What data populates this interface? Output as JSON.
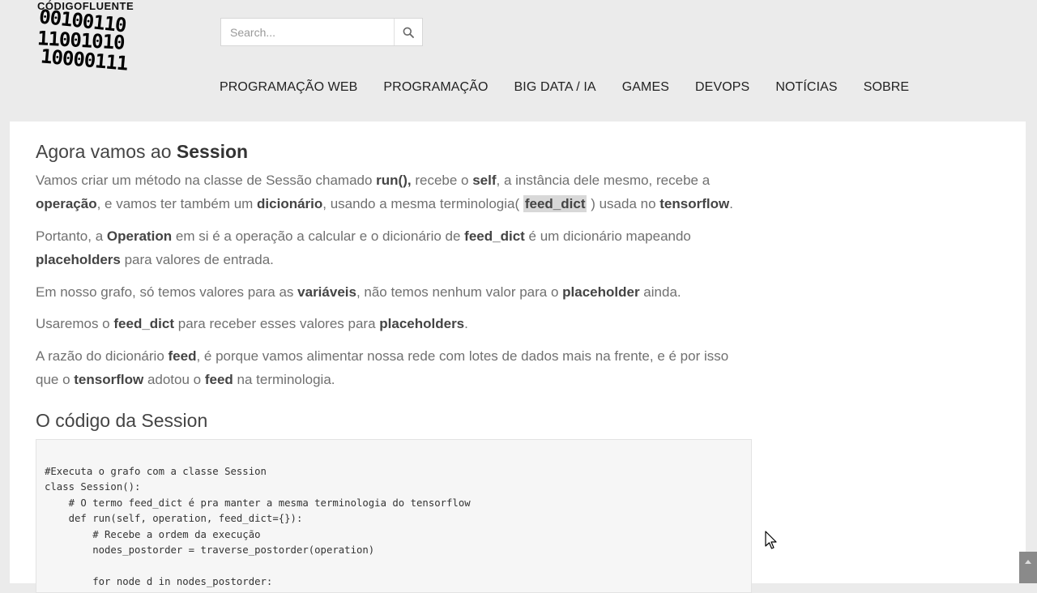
{
  "logo": {
    "name": "CÓDIGOFLUENTE",
    "bits": [
      "00100110",
      "11001010",
      "10000111"
    ]
  },
  "search": {
    "placeholder": "Search..."
  },
  "nav": [
    "PROGRAMAÇÃO WEB",
    "PROGRAMAÇÃO",
    "BIG DATA / IA",
    "GAMES",
    "DEVOPS",
    "NOTÍCIAS",
    "SOBRE"
  ],
  "article": {
    "heading1_prefix": "Agora vamos ao",
    "heading1_bold": "Session",
    "p1": {
      "t1": "Vamos criar um método na classe de Sessão chamado ",
      "b1": "run(),",
      "t2": "  recebe o ",
      "b2": "self",
      "t3": ", a instância dele mesmo, recebe a ",
      "b3": "operação",
      "t4": ", e vamos ter também um ",
      "b4": "dicionário",
      "t5": ", usando a mesma terminologia( ",
      "b5": "feed_dict",
      "t6": " ) usada no ",
      "b6": "tensorflow",
      "t7": "."
    },
    "p2": {
      "t1": "Portanto, a ",
      "b1": "Operation",
      "t2": " em si é a operação a calcular e o dicionário de ",
      "b2": "feed_dict",
      "t3": " é um dicionário mapeando ",
      "b3": "placeholders",
      "t4": " para valores de entrada."
    },
    "p3": {
      "t1": "Em nosso grafo, só temos valores para as ",
      "b1": "variáveis",
      "t2": ", não temos nenhum valor para o ",
      "b2": "placeholder",
      "t3": " ainda."
    },
    "p4": {
      "t1": "Usaremos o ",
      "b1": "feed_dict",
      "t2": " para receber esses valores para ",
      "b2": "placeholders",
      "t3": "."
    },
    "p5": {
      "t1": "A razão do dicionário ",
      "b1": "feed",
      "t2": ", é porque vamos alimentar nossa rede com lotes de dados mais na frente, e é por isso que o ",
      "b2": "tensorflow",
      "t3": " adotou o ",
      "b3": "feed",
      "t4": " na terminologia."
    },
    "heading2": "O código da Session",
    "code": "#Executa o grafo com a classe Session\nclass Session():\n    # O termo feed_dict é pra manter a mesma terminologia do tensorflow\n    def run(self, operation, feed_dict={}):\n        # Recebe a ordem da execução\n        nodes_postorder = traverse_postorder(operation)\n\n        for node d in nodes_postorder:"
  },
  "colors": {
    "page_bg": "#ebebeb",
    "content_bg": "#ffffff",
    "highlight": "#d8d8d8",
    "code_bg": "#f6f6f6"
  },
  "icons": {
    "search": "search-icon",
    "cursor": "mouse-pointer-icon",
    "scroll": "chevron-up-icon"
  }
}
